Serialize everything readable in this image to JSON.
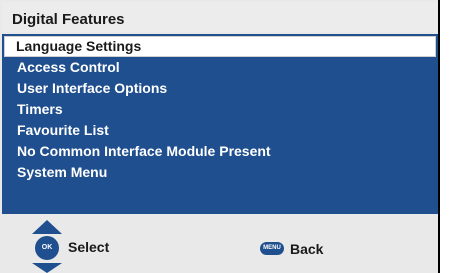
{
  "window": {
    "title": "Digital Features"
  },
  "menu": {
    "items": [
      {
        "label": "Language Settings",
        "selected": true
      },
      {
        "label": "Access Control",
        "selected": false
      },
      {
        "label": "User Interface Options",
        "selected": false
      },
      {
        "label": "Timers",
        "selected": false
      },
      {
        "label": "Favourite List",
        "selected": false
      },
      {
        "label": "No Common Interface Module Present",
        "selected": false
      },
      {
        "label": "System Menu",
        "selected": false
      }
    ]
  },
  "footer": {
    "nav_icon": "dpad-ok-icon",
    "ok_text": "OK",
    "select_label": "Select",
    "menu_key_icon": "menu-key-icon",
    "menu_key_text": "MENU",
    "back_label": "Back"
  },
  "colors": {
    "menu_background": "#1f4f8e",
    "selection_background": "#ffffff",
    "screen_background": "#e9e9e9"
  }
}
